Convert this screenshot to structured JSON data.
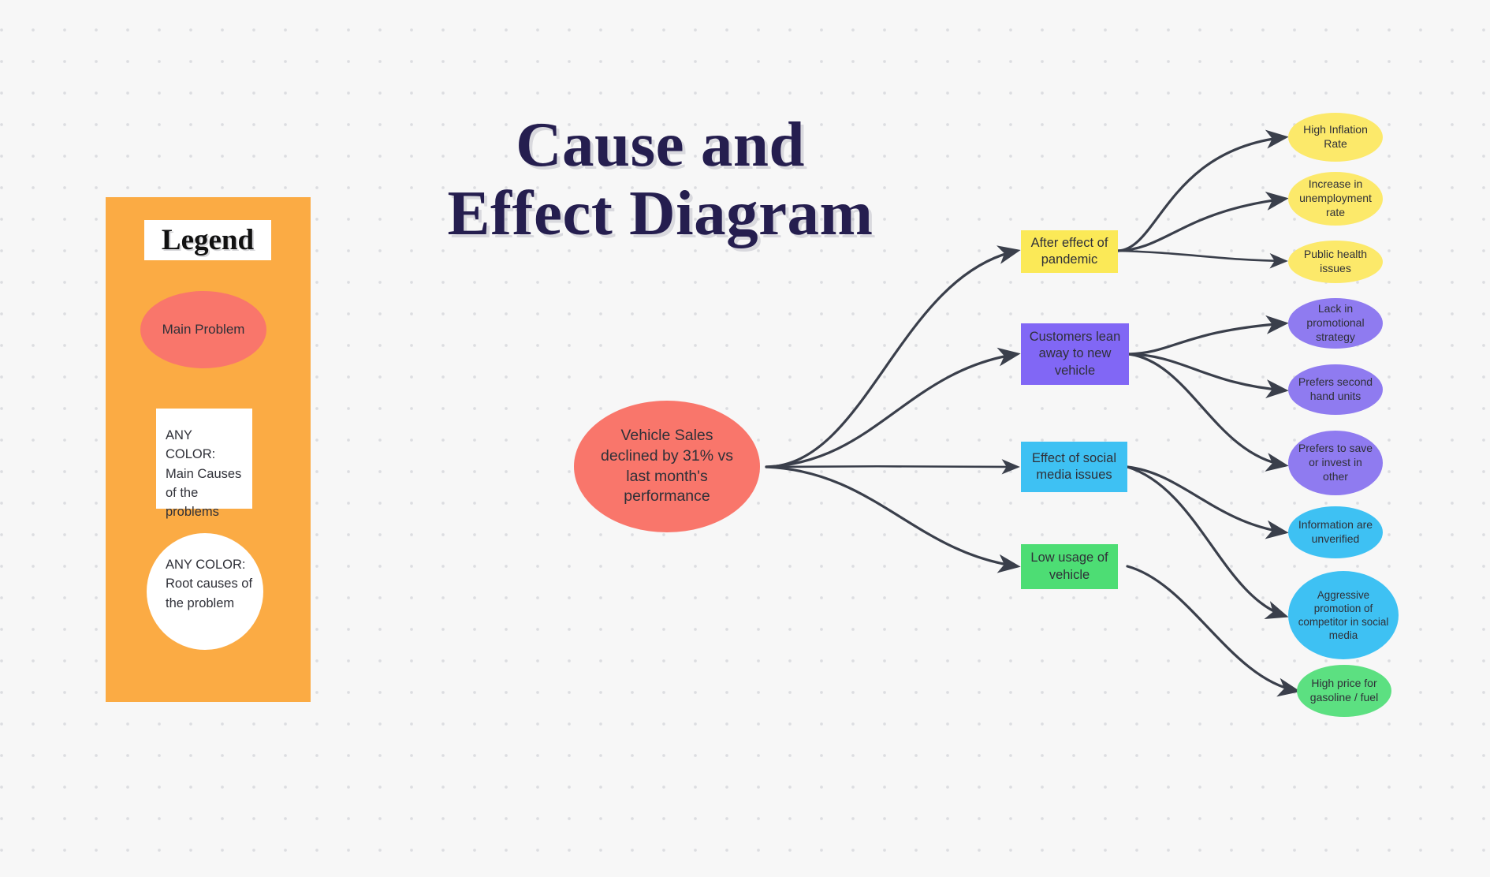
{
  "title": "Cause and Effect Diagram",
  "legend": {
    "heading": "Legend",
    "main_problem_label": "Main Problem",
    "main_causes_label": "ANY COLOR: Main Causes of the problems",
    "root_causes_label": "ANY COLOR: Root causes of the problem",
    "panel_color": "#fbab44",
    "main_problem_color": "#f9766b",
    "box_color": "#ffffff"
  },
  "center": {
    "label": "Vehicle Sales declined by 31% vs last month's performance",
    "color": "#f9766b"
  },
  "branches": [
    {
      "id": "pandemic",
      "label": "After effect of pandemic",
      "color": "#fbe957",
      "causes": [
        {
          "label": "High Inflation Rate",
          "color": "#fce96a"
        },
        {
          "label": "Increase in unemployment rate",
          "color": "#fce96a"
        },
        {
          "label": "Public health issues",
          "color": "#fce96a"
        }
      ]
    },
    {
      "id": "new-vehicle",
      "label": "Customers lean away to new vehicle",
      "color": "#8167f5",
      "causes": [
        {
          "label": "Lack in promotional strategy",
          "color": "#8f7bf0"
        },
        {
          "label": "Prefers second hand units",
          "color": "#8f7bf0"
        },
        {
          "label": "Prefers to save or invest in other",
          "color": "#8f7bf0"
        }
      ]
    },
    {
      "id": "social-media",
      "label": "Effect of social media issues",
      "color": "#3ec1f3",
      "causes": [
        {
          "label": "Information are unverified",
          "color": "#3ec1f3"
        },
        {
          "label": "Aggressive promotion of competitor  in social media",
          "color": "#3ec1f3"
        }
      ]
    },
    {
      "id": "low-usage",
      "label": "Low usage of vehicle",
      "color": "#4ddd74",
      "causes": [
        {
          "label": "High price for gasoline / fuel",
          "color": "#5ce081"
        }
      ]
    }
  ],
  "theme": {
    "background": "#f7f7f7",
    "dot": "#dcdde1",
    "title_color": "#251e4f",
    "link_color": "#3a3f4b"
  }
}
